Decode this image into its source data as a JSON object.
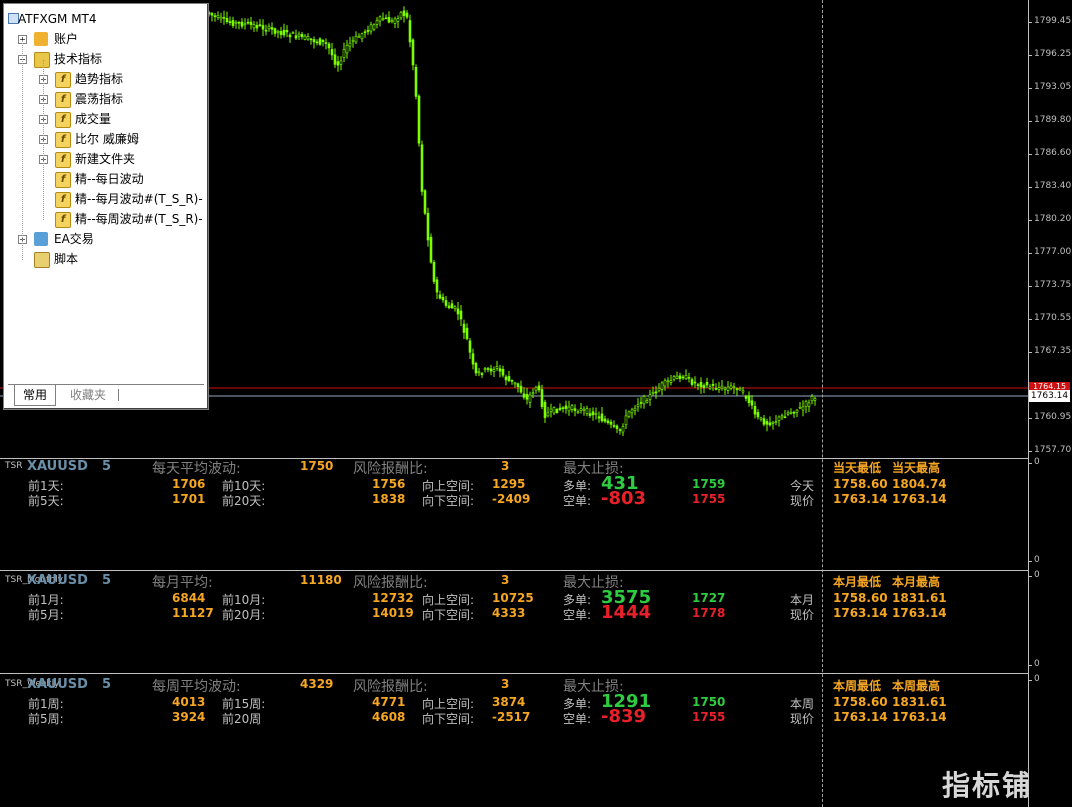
{
  "navigator": {
    "title": "ATFXGM MT4",
    "items": [
      {
        "label": "账户",
        "icon": "accounts-icon",
        "expander": "+"
      },
      {
        "label": "技术指标",
        "icon": "indicator-folder-icon",
        "expander": "−"
      },
      {
        "label": "趋势指标",
        "icon": "indicator-folder-icon",
        "expander": "+"
      },
      {
        "label": "震荡指标",
        "icon": "indicator-folder-icon",
        "expander": "+"
      },
      {
        "label": "成交量",
        "icon": "indicator-folder-icon",
        "expander": "+"
      },
      {
        "label": "比尔 威廉姆",
        "icon": "indicator-folder-icon",
        "expander": "+"
      },
      {
        "label": "新建文件夹",
        "icon": "indicator-folder-icon",
        "expander": "+"
      },
      {
        "label": "精--每日波动",
        "icon": "custom-indicator-icon"
      },
      {
        "label": "精--每月波动#(T_S_R)-",
        "icon": "custom-indicator-icon"
      },
      {
        "label": "精--每周波动#(T_S_R)-",
        "icon": "custom-indicator-icon"
      },
      {
        "label": "EA交易",
        "icon": "expert-advisor-icon",
        "expander": "+"
      },
      {
        "label": "脚本",
        "icon": "script-icon"
      }
    ],
    "tabs": [
      "常用",
      "收藏夹"
    ]
  },
  "price_axis": {
    "ticks": [
      "1799.45",
      "1796.25",
      "1793.05",
      "1789.80",
      "1786.60",
      "1783.40",
      "1780.20",
      "1777.00",
      "1773.75",
      "1770.55",
      "1767.35",
      "1760.95",
      "1757.70"
    ],
    "current_price": "1763.14",
    "red_line_label": "1764.15",
    "panel_max": "0",
    "panel_min": "0"
  },
  "panels": [
    {
      "tag": "TSR",
      "symbol": "XAUUSD",
      "symbol_overlay": "",
      "five": "5",
      "avg_label": "每天平均波动:",
      "avg_value": "1750",
      "rr_label": "风险报酬比:",
      "rr_value": "3",
      "maxsl_label": "最大止损:",
      "row1": {
        "label_a": "前1天:",
        "val_a": "1706",
        "label_b": "前10天:",
        "val_b": "1756"
      },
      "row2": {
        "label_a": "前5天:",
        "val_a": "1701",
        "label_b": "前20天:",
        "val_b": "1838"
      },
      "up_label": "向上空间:",
      "up_value": "1295",
      "down_label": "向下空间:",
      "down_value": "-2409",
      "long_label": "多单:",
      "long_big": "431",
      "long_small": "1759",
      "short_label": "空单:",
      "short_big": "-803",
      "short_small": "1755",
      "period_label": "今天",
      "now_label": "现价",
      "low_head": "当天最低",
      "high_head": "当天最高",
      "low_val": "1758.60",
      "high_val": "1804.74",
      "now_low": "1763.14",
      "now_high": "1763.14"
    },
    {
      "tag": "TSR_Monthly",
      "symbol": "XAUUSD",
      "five": "5",
      "avg_label": "每月平均:",
      "avg_value": "11180",
      "rr_label": "风险报酬比:",
      "rr_value": "3",
      "maxsl_label": "最大止损:",
      "row1": {
        "label_a": "前1月:",
        "val_a": "6844",
        "label_b": "前10月:",
        "val_b": "12732"
      },
      "row2": {
        "label_a": "前5月:",
        "val_a": "11127",
        "label_b": "前20月:",
        "val_b": "14019"
      },
      "up_label": "向上空间:",
      "up_value": "10725",
      "down_label": "向下空间:",
      "down_value": "4333",
      "long_label": "多单:",
      "long_big": "3575",
      "long_small": "1727",
      "short_label": "空单:",
      "short_big": "1444",
      "short_small": "1778",
      "period_label": "本月",
      "now_label": "现价",
      "low_head": "本月最低",
      "high_head": "本月最高",
      "low_val": "1758.60",
      "high_val": "1831.61",
      "now_low": "1763.14",
      "now_high": "1763.14"
    },
    {
      "tag": "TSR_Weekly",
      "symbol": "XAUUSD",
      "five": "5",
      "avg_label": "每周平均波动:",
      "avg_value": "4329",
      "rr_label": "风险报酬比:",
      "rr_value": "3",
      "maxsl_label": "最大止损:",
      "row1": {
        "label_a": "前1周:",
        "val_a": "4013",
        "label_b": "前15周:",
        "val_b": "4771"
      },
      "row2": {
        "label_a": "前5周:",
        "val_a": "3924",
        "label_b": "前20周",
        "val_b": "4608"
      },
      "up_label": "向上空间:",
      "up_value": "3874",
      "down_label": "向下空间:",
      "down_value": "-2517",
      "long_label": "多单:",
      "long_big": "1291",
      "long_small": "1750",
      "short_label": "空单:",
      "short_big": "-839",
      "short_small": "1755",
      "period_label": "本周",
      "now_label": "现价",
      "low_head": "本周最低",
      "high_head": "本周最高",
      "low_val": "1758.60",
      "high_val": "1831.61",
      "now_low": "1763.14",
      "now_high": "1763.14"
    }
  ],
  "watermark": "指标铺",
  "colors": {
    "candle": "#7CFC00",
    "background": "#000000",
    "current_price_line": "#8fa8c0",
    "red_line": "#d01010"
  }
}
